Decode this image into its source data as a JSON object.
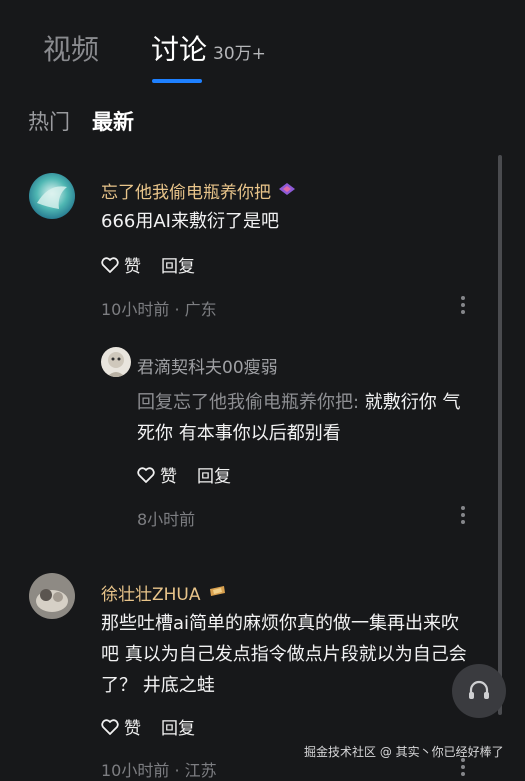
{
  "tabs": {
    "video": "视频",
    "discuss": "讨论",
    "count": "30万+"
  },
  "sort": {
    "hot": "热门",
    "latest": "最新"
  },
  "comments": [
    {
      "author": "忘了他我偷电瓶养你把",
      "text": "666用AI来敷衍了是吧",
      "like_label": "赞",
      "reply_label": "回复",
      "meta": "10小时前 · 广东",
      "replies": [
        {
          "author": "君滴契科夫00瘦弱",
          "reply_prefix": "回复忘了他我偷电瓶养你把:",
          "text": " 就敷衍你 气死你 有本事你以后都别看",
          "like_label": "赞",
          "reply_label": "回复",
          "meta": "8小时前"
        }
      ]
    },
    {
      "author": "徐壮壮ZHUA",
      "text": "那些吐槽ai简单的麻烦你真的做一集再出来吹吧 真以为自己发点指令做点片段就以为自己会了？ 井底之蛙",
      "like_label": "赞",
      "reply_label": "回复",
      "meta": "10小时前 · 江苏"
    }
  ],
  "watermark": "掘金技术社区 @ 其实丶你已经好棒了",
  "colors": {
    "accent": "#1e80ff",
    "author": "#e8c48a",
    "background": "#17181a"
  }
}
